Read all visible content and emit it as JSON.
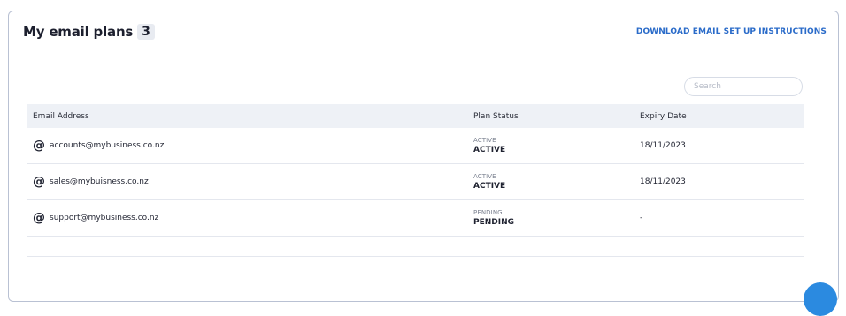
{
  "header": {
    "title": "My email plans",
    "count": "3",
    "download_link": "DOWNLOAD EMAIL SET UP INSTRUCTIONS"
  },
  "search": {
    "placeholder": "Search",
    "value": ""
  },
  "table": {
    "columns": [
      "Email Address",
      "Plan Status",
      "Expiry Date"
    ],
    "rows": [
      {
        "email": "accounts@mybusiness.co.nz",
        "status_small": "ACTIVE",
        "status": "ACTIVE",
        "expiry": "18/11/2023"
      },
      {
        "email": "sales@mybuisness.co.nz",
        "status_small": "ACTIVE",
        "status": "ACTIVE",
        "expiry": "18/11/2023"
      },
      {
        "email": "support@mybusiness.co.nz",
        "status_small": "PENDING",
        "status": "PENDING",
        "expiry": "-"
      }
    ]
  },
  "icons": {
    "email": "at-icon",
    "chat": "chat-bubble-icon"
  },
  "colors": {
    "link": "#2a6bc9",
    "header_bg": "#eef1f6",
    "chat_bubble": "#2b8ae0"
  }
}
